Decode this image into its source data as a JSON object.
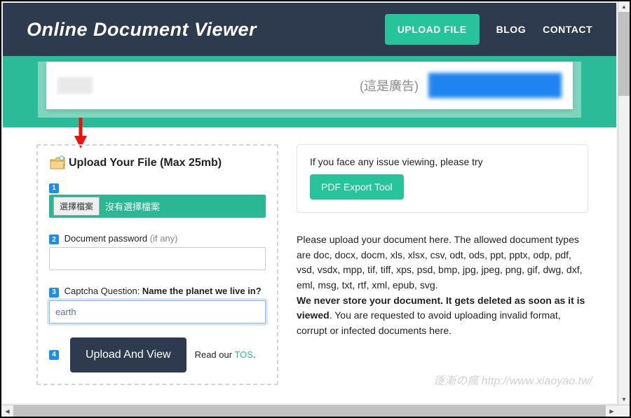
{
  "header": {
    "title": "Online Document Viewer",
    "nav": {
      "upload": "UPLOAD FILE",
      "blog": "BLOG",
      "contact": "CONTACT"
    }
  },
  "ad": {
    "label": "(這是廣告)"
  },
  "upload": {
    "title": "Upload Your File (Max 25mb)",
    "step1": "1",
    "choose_btn": "選擇檔案",
    "no_file": "沒有選擇檔案",
    "step2": "2",
    "pw_label": "Document password ",
    "pw_hint": "(if any)",
    "pw_value": "",
    "step3": "3",
    "captcha_label_prefix": "Captcha Question: ",
    "captcha_question": "Name the planet we live in?",
    "captcha_value": "earth",
    "step4": "4",
    "submit": "Upload And View",
    "tos_prefix": "Read our ",
    "tos_link": "TOS",
    "tos_suffix": "."
  },
  "notice": {
    "text": "If you face any issue viewing, please try",
    "btn": "PDF Export Tool"
  },
  "desc": {
    "p1": "Please upload your document here. The allowed document types are doc, docx, docm, xls, xlsx, csv, odt, ods, ppt, pptx, odp, pdf, vsd, vsdx, mpp, tif, tiff, xps, psd, bmp, jpg, jpeg, png, gif, dwg, dxf, eml, msg, txt, rtf, xml, epub, svg.",
    "p2a": "We never store your document. It gets deleted as soon as it is viewed",
    "p2b": ". You are requested to avoid uploading invalid format, corrupt or infected documents here."
  },
  "watermark": "逐漸の瘋 http://www.xiaoyao.tw/"
}
